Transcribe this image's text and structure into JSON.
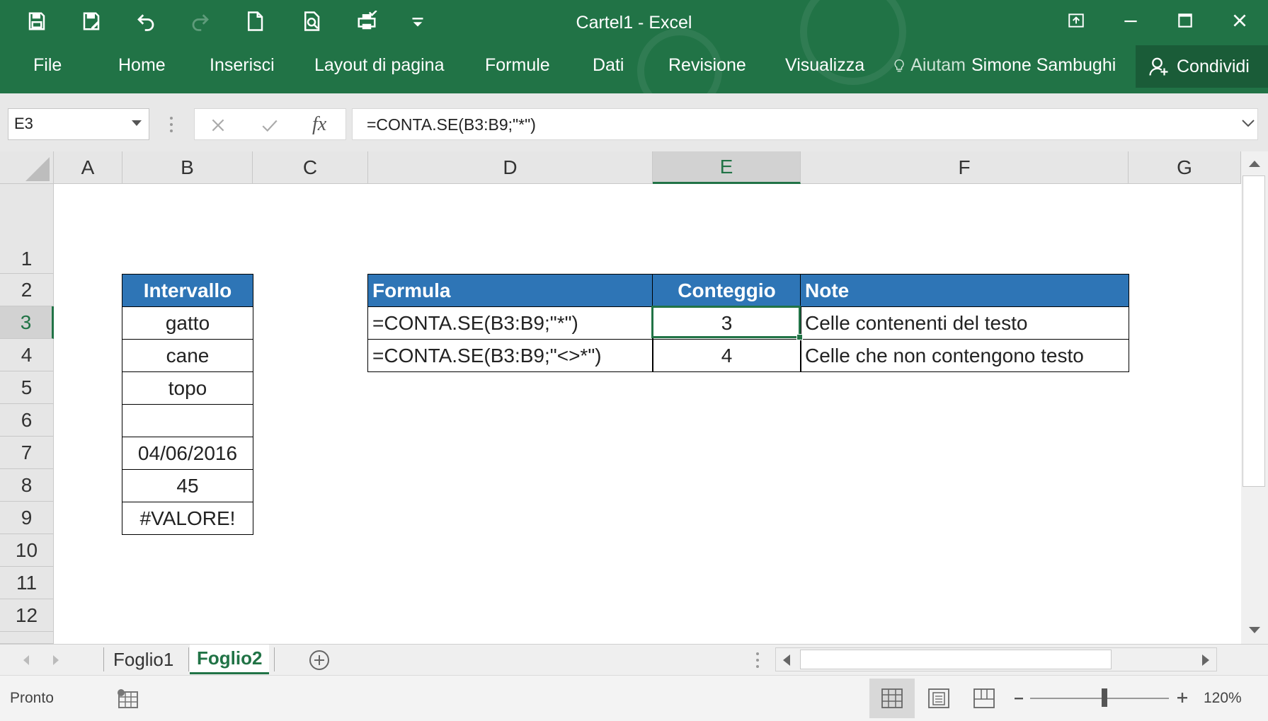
{
  "window": {
    "title": "Cartel1 - Excel",
    "accent": "#217346"
  },
  "ribbon": {
    "tabs": [
      "File",
      "Home",
      "Inserisci",
      "Layout di pagina",
      "Formule",
      "Dati",
      "Revisione",
      "Visualizza"
    ],
    "tell_me": "Aiutam",
    "user": "Simone Sambughi",
    "share": "Condividi"
  },
  "formula_bar": {
    "name_box": "E3",
    "fx": "fx",
    "formula": "=CONTA.SE(B3:B9;\"*\")"
  },
  "grid": {
    "columns": [
      "A",
      "B",
      "C",
      "D",
      "E",
      "F",
      "G"
    ],
    "selected_column": "E",
    "rows": [
      "1",
      "2",
      "3",
      "4",
      "5",
      "6",
      "7",
      "8",
      "9",
      "10",
      "11",
      "12"
    ],
    "selected_row": "3",
    "header_color": "#2e75b6"
  },
  "range_table": {
    "header": "Intervallo",
    "values": [
      "gatto",
      "cane",
      "topo",
      "",
      "04/06/2016",
      "45",
      "#VALORE!"
    ]
  },
  "results_table": {
    "headers": [
      "Formula",
      "Conteggio",
      "Note"
    ],
    "rows": [
      [
        "=CONTA.SE(B3:B9;\"*\")",
        "3",
        "Celle contenenti del testo"
      ],
      [
        "=CONTA.SE(B3:B9;\"<>*\")",
        "4",
        "Celle che non contengono testo"
      ]
    ]
  },
  "sheets": {
    "tabs": [
      "Foglio1",
      "Foglio2"
    ],
    "active": "Foglio2"
  },
  "status": {
    "text": "Pronto",
    "zoom": "120%"
  }
}
